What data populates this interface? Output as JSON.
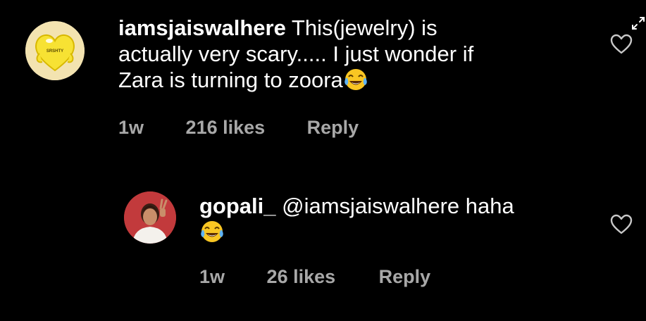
{
  "comments": [
    {
      "username": "iamsjaiswalhere",
      "text_line1": "This(jewelry) is",
      "text_line2": "actually very scary..... I just wonder if",
      "text_line3": "Zara is turning to zoora",
      "emoji": "face-with-tears-of-joy",
      "age": "1w",
      "likes": "216 likes",
      "reply_label": "Reply",
      "avatar_badge": "SRSHTY"
    },
    {
      "username": "gopali_",
      "text": "@iamsjaiswalhere haha",
      "emoji": "face-with-tears-of-joy",
      "age": "1w",
      "likes": "26 likes",
      "reply_label": "Reply"
    }
  ],
  "icons": {
    "like": "heart-outline-icon",
    "expand": "expand-arrows-icon"
  },
  "colors": {
    "background": "#000000",
    "text": "#ffffff",
    "meta": "#a8a8a8",
    "avatar_yellow": "#f7e233"
  }
}
